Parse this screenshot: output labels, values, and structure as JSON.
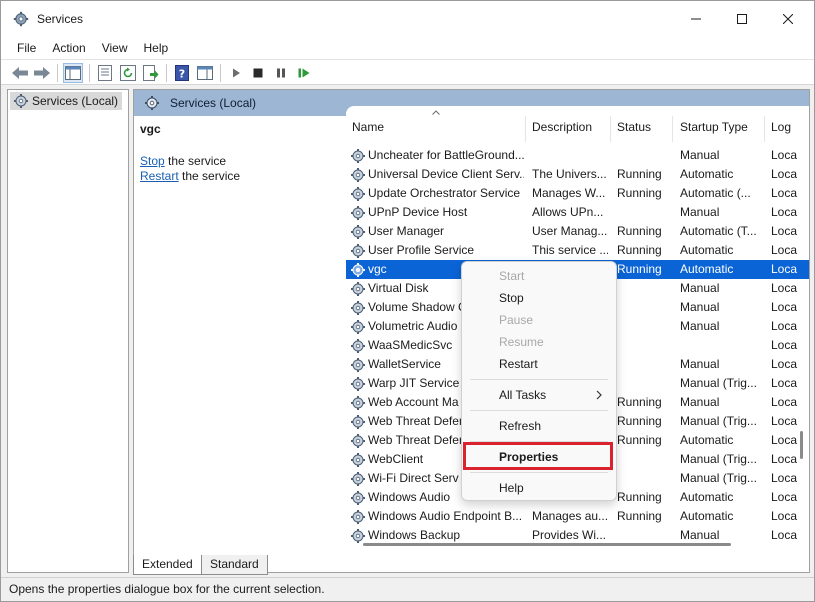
{
  "window": {
    "title": "Services",
    "controls": {
      "minimize": "minimize-icon",
      "maximize": "maximize-icon",
      "close": "close-icon"
    }
  },
  "menu": [
    "File",
    "Action",
    "View",
    "Help"
  ],
  "toolbar": {
    "icons": [
      "back-arrow-icon",
      "forward-arrow-icon",
      "console-tree-icon",
      "properties-sheet-icon",
      "refresh-icon",
      "export-list-icon",
      "help-icon",
      "show-hide-action-pane-icon",
      "start-service-icon",
      "stop-service-icon",
      "pause-service-icon",
      "restart-service-icon"
    ]
  },
  "tree": {
    "selected_label": "Services (Local)"
  },
  "pane": {
    "header_title": "Services (Local)"
  },
  "description": {
    "service_name": "vgc",
    "stop_link": "Stop",
    "stop_rest": " the service",
    "restart_link": "Restart",
    "restart_rest": " the service"
  },
  "columns": [
    "Name",
    "Description",
    "Status",
    "Startup Type",
    "Log"
  ],
  "rows": [
    {
      "name": "Uncheater for BattleGround...",
      "description": "",
      "status": "",
      "startup": "Manual",
      "log": "Loca"
    },
    {
      "name": "Universal Device Client Serv...",
      "description": "The Univers...",
      "status": "Running",
      "startup": "Automatic",
      "log": "Loca"
    },
    {
      "name": "Update Orchestrator Service",
      "description": "Manages W...",
      "status": "Running",
      "startup": "Automatic (...",
      "log": "Loca"
    },
    {
      "name": "UPnP Device Host",
      "description": "Allows UPn...",
      "status": "",
      "startup": "Manual",
      "log": "Loca"
    },
    {
      "name": "User Manager",
      "description": "User Manag...",
      "status": "Running",
      "startup": "Automatic (T...",
      "log": "Loca"
    },
    {
      "name": "User Profile Service",
      "description": "This service ...",
      "status": "Running",
      "startup": "Automatic",
      "log": "Loca"
    },
    {
      "name": "vgc",
      "description": "",
      "status": "Running",
      "startup": "Automatic",
      "log": "Loca"
    },
    {
      "name": "Virtual Disk",
      "description": "",
      "status": "",
      "startup": "Manual",
      "log": "Loca"
    },
    {
      "name": "Volume Shadow C",
      "description": "",
      "status": "",
      "startup": "Manual",
      "log": "Loca"
    },
    {
      "name": "Volumetric Audio",
      "description": "",
      "status": "",
      "startup": "Manual",
      "log": "Loca"
    },
    {
      "name": "WaaSMedicSvc",
      "description": "",
      "status": "",
      "startup": "",
      "log": "Loca"
    },
    {
      "name": "WalletService",
      "description": "",
      "status": "",
      "startup": "Manual",
      "log": "Loca"
    },
    {
      "name": "Warp JIT Service",
      "description": "",
      "status": "",
      "startup": "Manual (Trig...",
      "log": "Loca"
    },
    {
      "name": "Web Account Ma",
      "description": "",
      "status": "Running",
      "startup": "Manual",
      "log": "Loca"
    },
    {
      "name": "Web Threat Defen",
      "description": "",
      "status": "Running",
      "startup": "Manual (Trig...",
      "log": "Loca"
    },
    {
      "name": "Web Threat Defen",
      "description": "",
      "status": "Running",
      "startup": "Automatic",
      "log": "Loca"
    },
    {
      "name": "WebClient",
      "description": "",
      "status": "",
      "startup": "Manual (Trig...",
      "log": "Loca"
    },
    {
      "name": "Wi-Fi Direct Serv",
      "description": "",
      "status": "",
      "startup": "Manual (Trig...",
      "log": "Loca"
    },
    {
      "name": "Windows Audio",
      "description": "",
      "status": "Running",
      "startup": "Automatic",
      "log": "Loca"
    },
    {
      "name": "Windows Audio Endpoint B...",
      "description": "Manages au...",
      "status": "Running",
      "startup": "Automatic",
      "log": "Loca"
    },
    {
      "name": "Windows Backup",
      "description": "Provides Wi...",
      "status": "",
      "startup": "Manual",
      "log": "Loca"
    }
  ],
  "selected_row_index": 6,
  "context_menu": {
    "start": "Start",
    "stop": "Stop",
    "pause": "Pause",
    "resume": "Resume",
    "restart": "Restart",
    "all_tasks": "All Tasks",
    "refresh": "Refresh",
    "properties": "Properties",
    "help": "Help"
  },
  "tabs": [
    "Extended",
    "Standard"
  ],
  "status_bar": "Opens the properties dialogue box for the current selection.",
  "colors": {
    "selection": "#0a64d6",
    "pane_header": "#9cb6d4",
    "highlight": "#d9232e",
    "link": "#1a5fb4"
  }
}
